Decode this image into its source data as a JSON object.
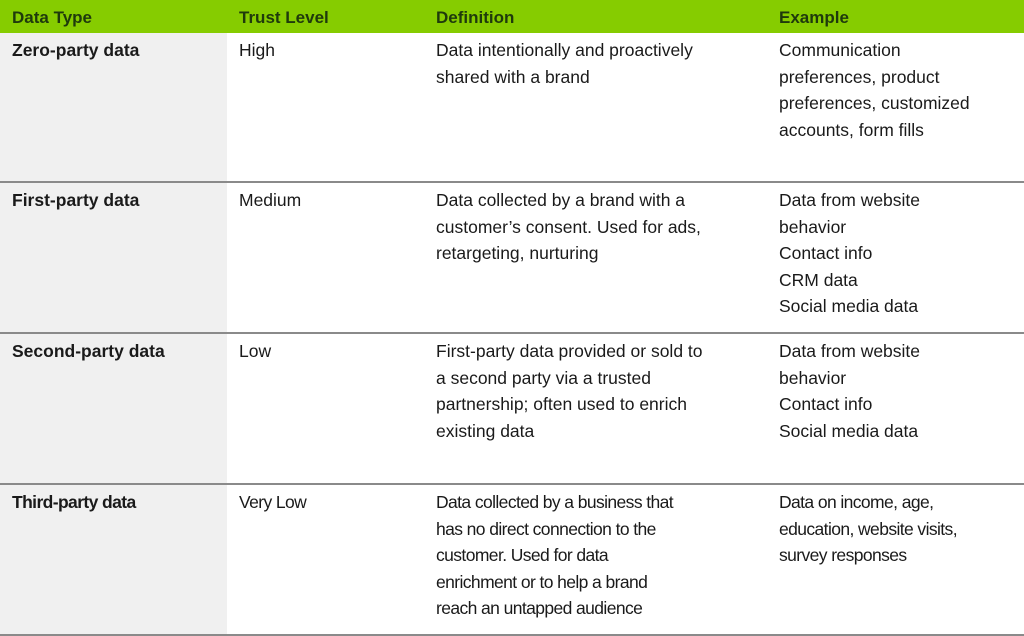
{
  "colors": {
    "header_bg": "#86cc00",
    "header_text": "#1f3a0c",
    "first_col_bg": "#f0f0f0",
    "row_divider": "#8a8a8a"
  },
  "table": {
    "headers": [
      "Data Type",
      "Trust Level",
      "Definition",
      "Example"
    ],
    "rows": [
      {
        "data_type": "Zero-party data",
        "trust_level": "High",
        "definition": [
          "Data intentionally and proactively",
          "shared with a brand"
        ],
        "example": [
          "Communication",
          "preferences, product",
          "preferences, customized",
          "accounts, form fills"
        ]
      },
      {
        "data_type": "First-party data",
        "trust_level": "Medium",
        "definition": [
          "Data collected by a brand with a",
          "customer’s consent. Used for ads,",
          "retargeting, nurturing"
        ],
        "example": [
          "Data from website",
          "behavior",
          "Contact info",
          "CRM data",
          "Social media data"
        ]
      },
      {
        "data_type": "Second-party data",
        "trust_level": "Low",
        "definition": [
          "First-party data provided or sold to",
          "a second party via a trusted",
          "partnership; often used to enrich",
          "existing data"
        ],
        "example": [
          "Data from website",
          "behavior",
          "Contact info",
          "Social media data"
        ]
      },
      {
        "data_type": "Third-party data",
        "trust_level": "Very Low",
        "definition": [
          "Data collected by a business that",
          "has no direct connection to the",
          "customer. Used for data",
          "enrichment or to help a brand",
          "reach an untapped audience"
        ],
        "example": [
          "Data on income, age,",
          "education, website visits,",
          "survey responses"
        ]
      }
    ]
  }
}
